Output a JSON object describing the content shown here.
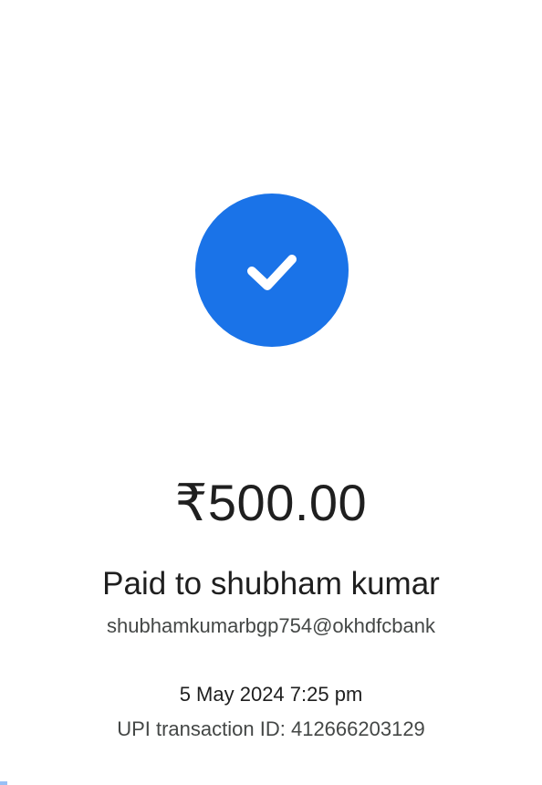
{
  "status": {
    "icon": "check-icon",
    "accent_color": "#1a73e8"
  },
  "payment": {
    "amount": "₹500.00",
    "paid_to": "Paid to shubham kumar",
    "vpa": "shubhamkumarbgp754@okhdfcbank",
    "datetime": "5 May 2024 7:25 pm",
    "upi_transaction_label": "UPI transaction ID:",
    "upi_transaction_id": "412666203129"
  }
}
